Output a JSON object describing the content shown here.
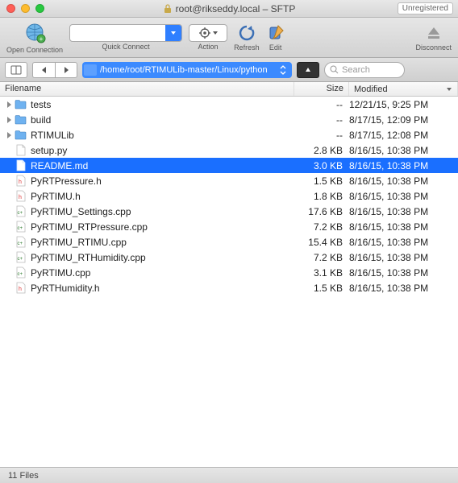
{
  "window": {
    "title": "root@rikseddy.local – SFTP",
    "unregistered": "Unregistered"
  },
  "toolbar": {
    "open_connection": "Open Connection",
    "quick_connect": "Quick Connect",
    "action": "Action",
    "refresh": "Refresh",
    "edit": "Edit",
    "disconnect": "Disconnect"
  },
  "pathbar": {
    "path": "/home/root/RTIMULib-master/Linux/python",
    "search_placeholder": "Search"
  },
  "columns": {
    "name": "Filename",
    "size": "Size",
    "modified": "Modified"
  },
  "files": [
    {
      "name": "tests",
      "kind": "folder",
      "size": "--",
      "modified": "12/21/15, 9:25 PM",
      "selected": false
    },
    {
      "name": "build",
      "kind": "folder",
      "size": "--",
      "modified": "8/17/15, 12:09 PM",
      "selected": false
    },
    {
      "name": "RTIMULib",
      "kind": "folder",
      "size": "--",
      "modified": "8/17/15, 12:08 PM",
      "selected": false
    },
    {
      "name": "setup.py",
      "kind": "file",
      "size": "2.8 KB",
      "modified": "8/16/15, 10:38 PM",
      "selected": false
    },
    {
      "name": "README.md",
      "kind": "file",
      "size": "3.0 KB",
      "modified": "8/16/15, 10:38 PM",
      "selected": true
    },
    {
      "name": "PyRTPressure.h",
      "kind": "h",
      "size": "1.5 KB",
      "modified": "8/16/15, 10:38 PM",
      "selected": false
    },
    {
      "name": "PyRTIMU.h",
      "kind": "h",
      "size": "1.8 KB",
      "modified": "8/16/15, 10:38 PM",
      "selected": false
    },
    {
      "name": "PyRTIMU_Settings.cpp",
      "kind": "cpp",
      "size": "17.6 KB",
      "modified": "8/16/15, 10:38 PM",
      "selected": false
    },
    {
      "name": "PyRTIMU_RTPressure.cpp",
      "kind": "cpp",
      "size": "7.2 KB",
      "modified": "8/16/15, 10:38 PM",
      "selected": false
    },
    {
      "name": "PyRTIMU_RTIMU.cpp",
      "kind": "cpp",
      "size": "15.4 KB",
      "modified": "8/16/15, 10:38 PM",
      "selected": false
    },
    {
      "name": "PyRTIMU_RTHumidity.cpp",
      "kind": "cpp",
      "size": "7.2 KB",
      "modified": "8/16/15, 10:38 PM",
      "selected": false
    },
    {
      "name": "PyRTIMU.cpp",
      "kind": "cpp",
      "size": "3.1 KB",
      "modified": "8/16/15, 10:38 PM",
      "selected": false
    },
    {
      "name": "PyRTHumidity.h",
      "kind": "h",
      "size": "1.5 KB",
      "modified": "8/16/15, 10:38 PM",
      "selected": false
    }
  ],
  "status": {
    "count": "11 Files"
  }
}
